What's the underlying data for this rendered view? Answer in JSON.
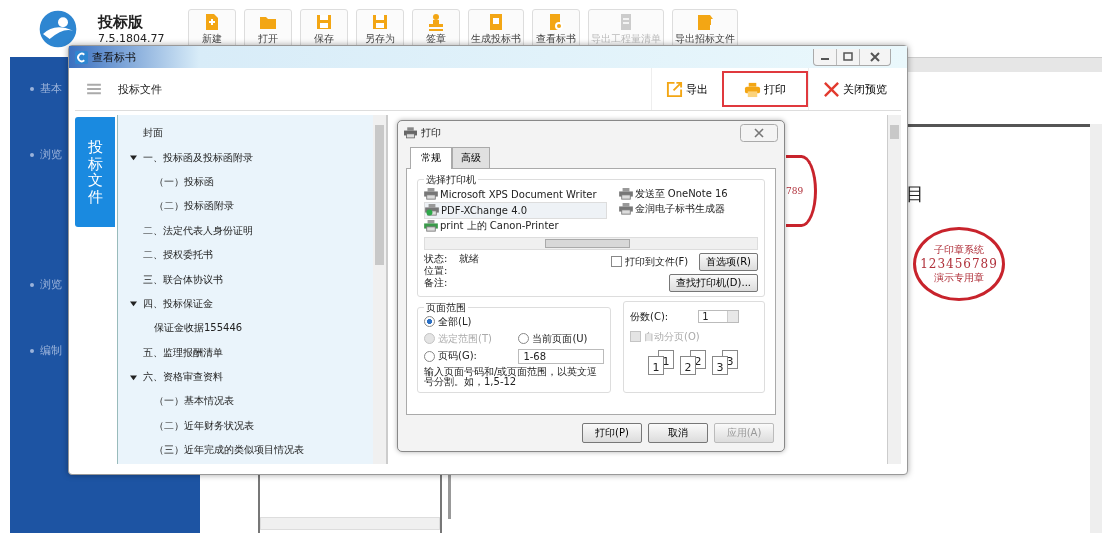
{
  "app": {
    "title": "投标版",
    "version": "7.5.1804.77"
  },
  "toolbar": [
    {
      "label": "新建",
      "disabled": false
    },
    {
      "label": "打开",
      "disabled": false
    },
    {
      "label": "保存",
      "disabled": false
    },
    {
      "label": "另存为",
      "disabled": false
    },
    {
      "label": "签章",
      "disabled": false
    },
    {
      "label": "生成投标书",
      "disabled": false
    },
    {
      "label": "查看标书",
      "disabled": false
    },
    {
      "label": "导出工程量清单",
      "disabled": true
    },
    {
      "label": "导出招标文件",
      "disabled": false
    }
  ],
  "sidebar": {
    "items": [
      {
        "label": "基本"
      },
      {
        "label": "浏览"
      },
      {
        "label": "浏览"
      },
      {
        "label": "编制"
      }
    ]
  },
  "document": {
    "heading_fragment": "目",
    "seal": {
      "lines": [
        "子印章系统",
        "123456789",
        "演示专用章"
      ]
    }
  },
  "viewer": {
    "title": "查看标书",
    "section": "投标文件",
    "actions": [
      {
        "label": "导出",
        "kind": "export",
        "selected": false
      },
      {
        "label": "打印",
        "kind": "print",
        "selected": true
      },
      {
        "label": "关闭预览",
        "kind": "close",
        "selected": false
      }
    ],
    "side_tab": "投标文件",
    "seal_fragment": "789",
    "tree": [
      {
        "label": "封面"
      },
      {
        "label": "一、投标函及投标函附录",
        "expanded": true,
        "children": [
          {
            "label": "（一）投标函"
          },
          {
            "label": "（二）投标函附录"
          }
        ]
      },
      {
        "label": "二、法定代表人身份证明"
      },
      {
        "label": "二、授权委托书"
      },
      {
        "label": "三、联合体协议书"
      },
      {
        "label": "四、投标保证金",
        "expanded": true,
        "children": [
          {
            "label": "保证金收据155446"
          }
        ]
      },
      {
        "label": "五、监理报酬清单"
      },
      {
        "label": "六、资格审查资料",
        "expanded": true,
        "children": [
          {
            "label": "（一）基本情况表"
          },
          {
            "label": "（二）近年财务状况表"
          },
          {
            "label": "（三）近年完成的类似项目情况表"
          }
        ]
      }
    ]
  },
  "print_dialog": {
    "title": "打印",
    "tabs": [
      {
        "label": "常规",
        "selected": true
      },
      {
        "label": "高级",
        "selected": false
      }
    ],
    "printer_group": "选择打印机",
    "printers": [
      {
        "name": "Microsoft XPS Document Writer",
        "kind": "local",
        "selected": false,
        "default": false
      },
      {
        "name": "PDF-XChange 4.0",
        "kind": "local",
        "selected": true,
        "default": true
      },
      {
        "name": "print 上的 Canon-Printer",
        "kind": "network",
        "selected": false,
        "default": false
      },
      {
        "name": "发送至 OneNote 16",
        "kind": "local",
        "selected": false,
        "default": false
      },
      {
        "name": "金润电子标书生成器",
        "kind": "local",
        "selected": false,
        "default": false
      }
    ],
    "status": [
      {
        "label": "状态:",
        "value": "就绪"
      },
      {
        "label": "位置:"
      },
      {
        "label": "备注:"
      }
    ],
    "print_to_file": {
      "label": "打印到文件(F)",
      "checked": false
    },
    "preferences_button": "首选项(R)",
    "find_printer_button": "查找打印机(D)...",
    "range_group": "页面范围",
    "range_options": [
      {
        "label": "全部(L)",
        "selected": true,
        "disabled": false
      },
      {
        "label": "选定范围(T)",
        "selected": false,
        "disabled": true
      },
      {
        "label": "当前页面(U)",
        "selected": false,
        "disabled": false
      },
      {
        "label": "页码(G):",
        "selected": false,
        "disabled": false
      }
    ],
    "page_value": "1-68",
    "range_hint": "输入页面号码和/或页面范围，以英文逗号分割。如，1,5-12",
    "copies_label": "份数(C):",
    "copies": "1",
    "collate": {
      "label": "自动分页(O)",
      "checked": false,
      "disabled": true
    },
    "collate_pages": [
      {
        "front": "1",
        "back": "1"
      },
      {
        "front": "2",
        "back": "2"
      },
      {
        "front": "3",
        "back": "3"
      }
    ],
    "buttons": [
      {
        "label": "打印(P)",
        "disabled": false
      },
      {
        "label": "取消",
        "disabled": false
      },
      {
        "label": "应用(A)",
        "disabled": true
      }
    ]
  }
}
